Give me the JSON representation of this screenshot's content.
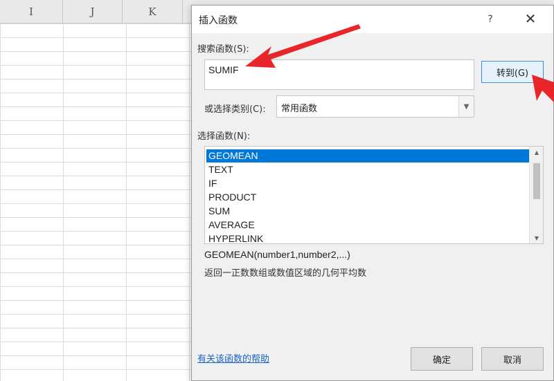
{
  "spreadsheet": {
    "columns": [
      "I",
      "J",
      "K"
    ]
  },
  "dialog": {
    "title": "插入函数",
    "help_icon": "?",
    "close_icon": "✕",
    "search_label": "搜索函数(S):",
    "search_value": "SUMIF",
    "goto_button": "转到(G)",
    "category_label": "或选择类别(C):",
    "category_value": "常用函数",
    "select_label": "选择函数(N):",
    "functions": [
      "GEOMEAN",
      "TEXT",
      "IF",
      "PRODUCT",
      "SUM",
      "AVERAGE",
      "HYPERLINK"
    ],
    "selected_function": "GEOMEAN",
    "signature": "GEOMEAN(number1,number2,...)",
    "description": "返回一正数数组或数值区域的几何平均数",
    "help_link": "有关该函数的帮助",
    "ok_button": "确定",
    "cancel_button": "取消"
  },
  "colors": {
    "accent": "#0078d7",
    "annotation_arrow": "#e8262a",
    "link": "#1a64c4"
  },
  "icons": {
    "category_dropdown": "chevron-down-icon",
    "scroll_up": "chevron-up-icon",
    "scroll_down": "chevron-down-icon"
  }
}
